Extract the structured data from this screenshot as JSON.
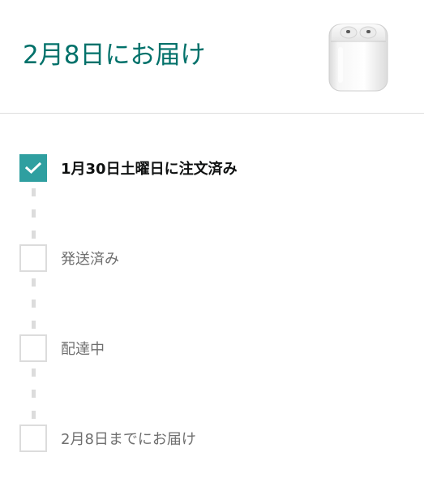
{
  "delivery": {
    "title": "2月8日にお届け"
  },
  "product": {
    "image_name": "airpods-case"
  },
  "steps": [
    {
      "label": "1月30日土曜日に注文済み",
      "status": "checked"
    },
    {
      "label": "発送済み",
      "status": "unchecked"
    },
    {
      "label": "配達中",
      "status": "unchecked"
    },
    {
      "label": "2月8日までにお届け",
      "status": "unchecked"
    }
  ],
  "colors": {
    "title_teal": "#00716a",
    "check_teal": "#2f9fa0",
    "box_border": "#dcdcdc",
    "divider": "#dedede"
  },
  "icons": {
    "checkmark": "check-icon"
  }
}
